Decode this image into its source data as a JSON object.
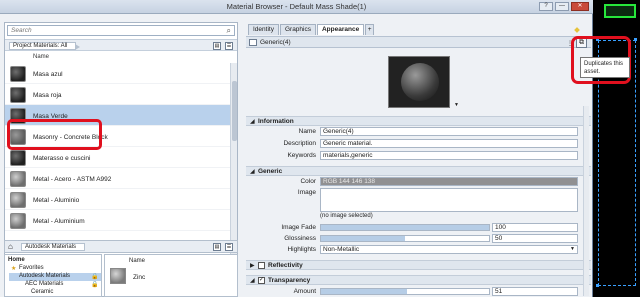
{
  "window": {
    "title": "Material Browser - Default Mass Shade(1)",
    "buttons": [
      "?",
      "—",
      "✕"
    ]
  },
  "left": {
    "search_placeholder": "Search",
    "library_label": "Project Materials: All",
    "column_name": "Name",
    "materials": [
      {
        "name": "Masa azul",
        "selected": false
      },
      {
        "name": "Masa roja",
        "selected": false
      },
      {
        "name": "Masa Verde",
        "selected": true
      },
      {
        "name": "Masonry - Concrete Block",
        "selected": false
      },
      {
        "name": "Materasso e cuscini",
        "selected": false
      },
      {
        "name": "Metal - Acero - ASTM A992",
        "selected": false
      },
      {
        "name": "Metal - Aluminio",
        "selected": false
      },
      {
        "name": "Metal - Aluminium",
        "selected": false
      }
    ]
  },
  "library": {
    "crumb": "Autodesk Materials",
    "tree": [
      "Home",
      "Favorites",
      "Autodesk Materials",
      "AEC Materials",
      "Ceramic"
    ],
    "column_name": "Name",
    "items": [
      "Zinc"
    ]
  },
  "right": {
    "tabs": [
      "Identity",
      "Graphics",
      "Appearance",
      "+"
    ],
    "asset_name": "Generic(4)",
    "sections": {
      "information": {
        "title": "Information",
        "name_label": "Name",
        "name_value": "Generic(4)",
        "description_label": "Description",
        "description_value": "Generic material.",
        "keywords_label": "Keywords",
        "keywords_value": "materials,generic"
      },
      "generic": {
        "title": "Generic",
        "color_label": "Color",
        "color_value": "RGB 144 146 138",
        "image_label": "Image",
        "image_note": "(no image selected)",
        "image_fade_label": "Image Fade",
        "image_fade_value": "100",
        "image_fade_fraction": 1.0,
        "glossiness_label": "Glossiness",
        "glossiness_value": "50",
        "glossiness_fraction": 0.5,
        "highlights_label": "Highlights",
        "highlights_value": "Non-Metallic"
      },
      "reflectivity": {
        "title": "Reflectivity"
      },
      "transparency": {
        "title": "Transparency",
        "amount_label": "Amount",
        "amount_value": "51",
        "amount_fraction": 0.51
      }
    }
  },
  "tooltip": {
    "text": "Duplicates this asset."
  }
}
